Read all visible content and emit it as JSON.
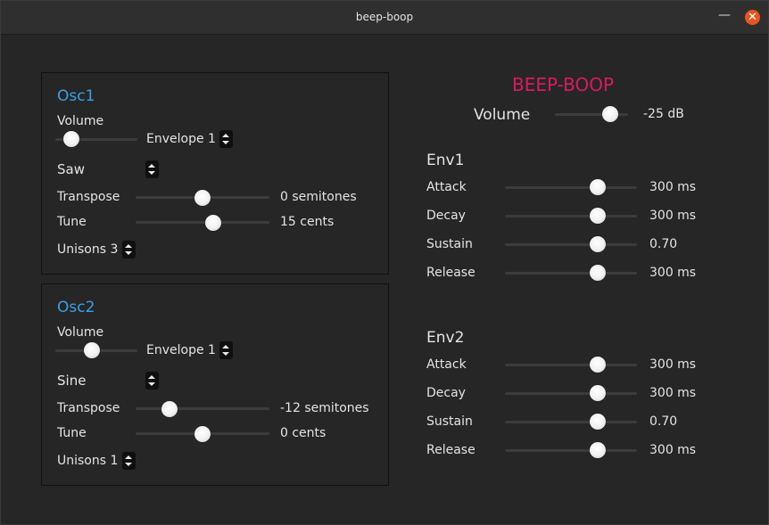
{
  "window": {
    "title": "beep-boop",
    "minimize_icon": "minimize-icon",
    "close_icon": "close-icon",
    "close_color": "#e95420"
  },
  "accent_color": "#3aa0e6",
  "brand_color": "#d81b60",
  "osc1": {
    "title": "Osc1",
    "volume_label": "Volume",
    "volume_level": 0.2,
    "envelope": "Envelope 1",
    "waveform": "Saw",
    "transpose_label": "Transpose",
    "transpose_value": "0 semitones",
    "transpose_level": 0.5,
    "tune_label": "Tune",
    "tune_value": "15 cents",
    "tune_level": 0.58,
    "unisons": "Unisons 3"
  },
  "osc2": {
    "title": "Osc2",
    "volume_label": "Volume",
    "volume_level": 0.45,
    "envelope": "Envelope 1",
    "waveform": "Sine",
    "transpose_label": "Transpose",
    "transpose_value": "-12 semitones",
    "transpose_level": 0.25,
    "tune_label": "Tune",
    "tune_value": "0 cents",
    "tune_level": 0.5,
    "unisons": "Unisons 1"
  },
  "master": {
    "brand": "BEEP-BOOP",
    "volume_label": "Volume",
    "volume_value": "-25 dB",
    "volume_level": 0.75
  },
  "env1": {
    "title": "Env1",
    "attack_label": "Attack",
    "attack_value": "300 ms",
    "attack_level": 0.7,
    "decay_label": "Decay",
    "decay_value": "300 ms",
    "decay_level": 0.7,
    "sustain_label": "Sustain",
    "sustain_value": "0.70",
    "sustain_level": 0.7,
    "release_label": "Release",
    "release_value": "300 ms",
    "release_level": 0.7
  },
  "env2": {
    "title": "Env2",
    "attack_label": "Attack",
    "attack_value": "300 ms",
    "attack_level": 0.7,
    "decay_label": "Decay",
    "decay_value": "300 ms",
    "decay_level": 0.7,
    "sustain_label": "Sustain",
    "sustain_value": "0.70",
    "sustain_level": 0.7,
    "release_label": "Release",
    "release_value": "300 ms",
    "release_level": 0.7
  }
}
